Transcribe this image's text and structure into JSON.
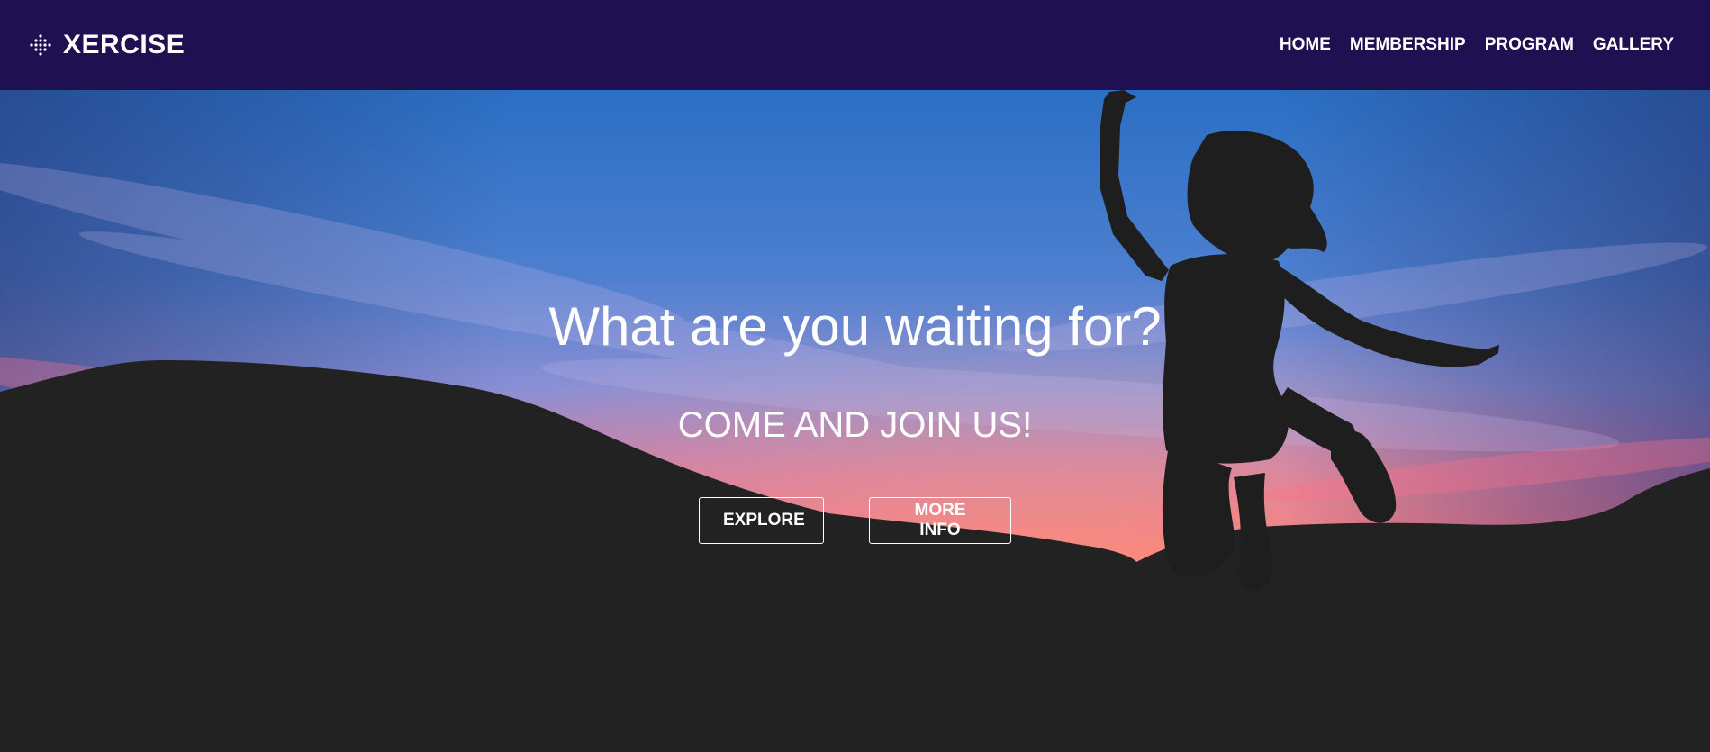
{
  "brand": {
    "name": "XERCISE",
    "icon": "dots-grid-icon",
    "color": "#1f1151"
  },
  "nav": {
    "items": [
      {
        "label": "HOME"
      },
      {
        "label": "MEMBERSHIP"
      },
      {
        "label": "PROGRAM"
      },
      {
        "label": "GALLERY"
      }
    ]
  },
  "hero": {
    "title": "What are you waiting for?",
    "subtitle": "COME AND JOIN US!",
    "buttons": {
      "explore": "EXPLORE",
      "more_info": "MORE INFO"
    },
    "background": "sunset sky with silhouette of hills and a jumping woman",
    "colors": {
      "sky_top": "#2a6fc4",
      "sky_pink": "#f46b8a",
      "sky_orange": "#ff9a5a",
      "silhouette": "#222222"
    }
  }
}
